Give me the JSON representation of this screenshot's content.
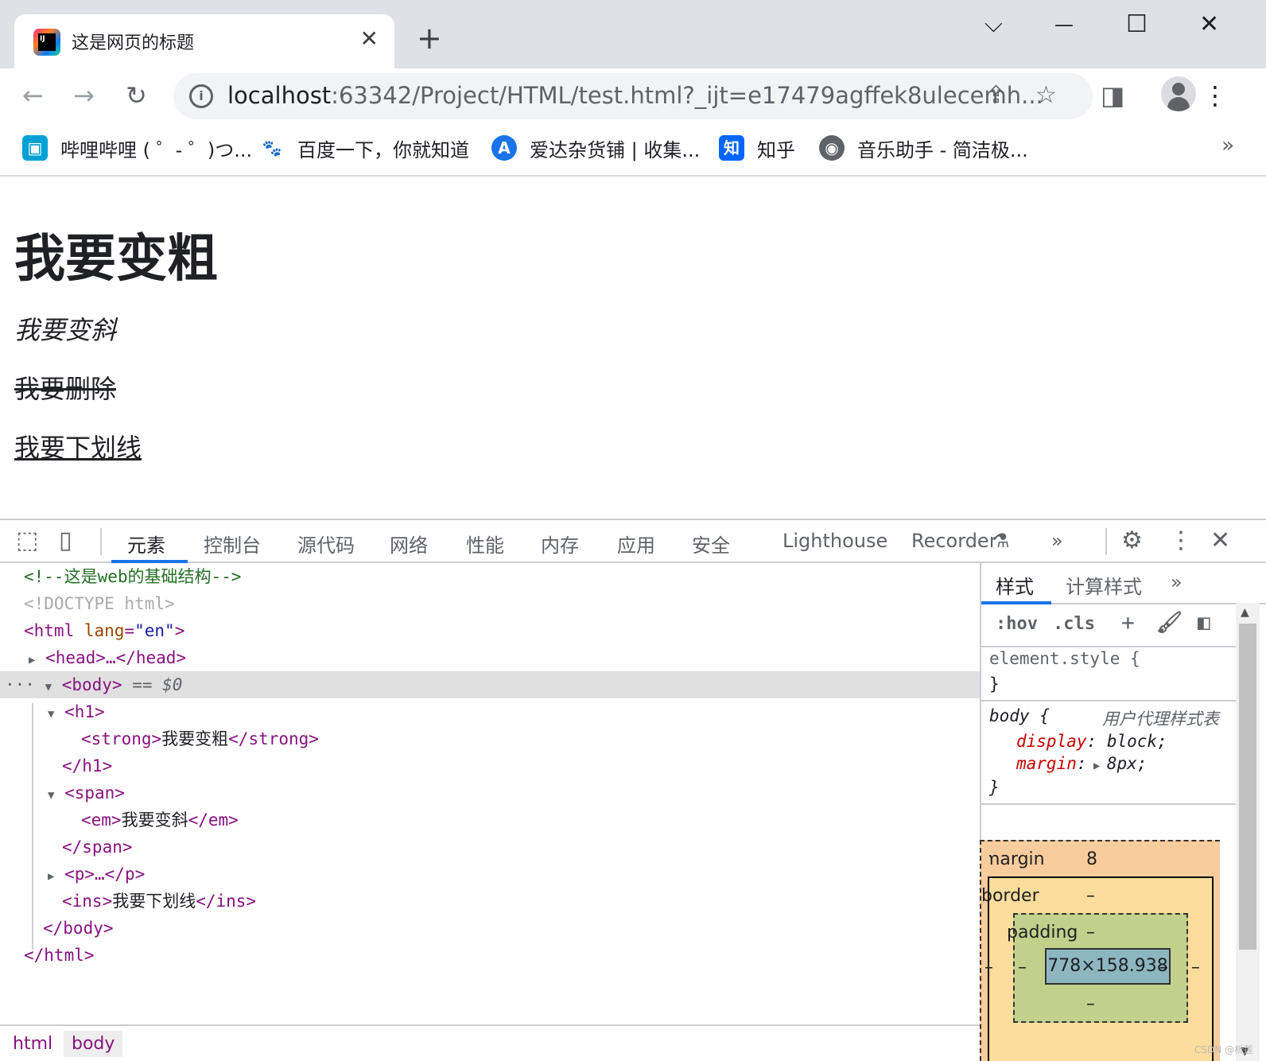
{
  "browser": {
    "tab": {
      "title": "这是网页的标题",
      "close": "✕"
    },
    "new_tab": "+",
    "window_controls": {
      "dropdown": "⌵",
      "minimize": "—",
      "maximize": "☐",
      "close": "✕"
    },
    "url": {
      "host": "localhost",
      "rest": ":63342/Project/HTML/test.html?_ijt=e17479agffek8ulecemh..."
    },
    "bookmarks": [
      {
        "label": "哔哩哔哩 ( ゜- ゜)つ...",
        "icon": "bilibili-icon",
        "color": "#00a1d6"
      },
      {
        "label": "百度一下，你就知道",
        "icon": "baidu-paw-icon",
        "color": "#2932e1"
      },
      {
        "label": "爱达杂货铺 | 收集...",
        "icon": "letter-a-icon",
        "color": "#1a73e8"
      },
      {
        "label": "知乎",
        "icon": "zhihu-icon",
        "color": "#0066ff"
      },
      {
        "label": "音乐助手 - 简洁极...",
        "icon": "globe-icon",
        "color": "#5f6368"
      }
    ],
    "bookmarks_more": "»"
  },
  "page": {
    "h1": "我要变粗",
    "em": "我要变斜",
    "del": "我要删除",
    "ins": "我要下划线"
  },
  "devtools": {
    "tabs": [
      "元素",
      "控制台",
      "源代码",
      "网络",
      "性能",
      "内存",
      "应用",
      "安全",
      "Lighthouse",
      "Recorder"
    ],
    "active_tab": "元素",
    "more": "»",
    "dom": {
      "comment": "<!--这是web的基础结构-->",
      "doctype": "<!DOCTYPE html>",
      "html_open": "<html",
      "lang_attr": "lang",
      "lang_val": "\"en\"",
      "gt": ">",
      "head": "<head>…</head>",
      "body_open": "<body>",
      "body_eq": "== $0",
      "h1_open": "<h1>",
      "strong_open": "<strong>",
      "strong_text": "我要变粗",
      "strong_close": "</strong>",
      "h1_close": "</h1>",
      "span_open": "<span>",
      "em_open": "<em>",
      "em_text": "我要变斜",
      "em_close": "</em>",
      "span_close": "</span>",
      "p": "<p>…</p>",
      "ins_open": "<ins>",
      "ins_text": "我要下划线",
      "ins_close": "</ins>",
      "body_close": "</body>",
      "html_close": "</html>",
      "ellipsis": "···"
    },
    "breadcrumbs": [
      "html",
      "body"
    ],
    "sidebar": {
      "tabs": [
        "样式",
        "计算样式"
      ],
      "more": "»",
      "tools": {
        "hov": ":hov",
        "cls": ".cls",
        "plus": "+"
      },
      "element_style": "element.style {",
      "close_brace": "}",
      "body_rule": "body {",
      "ua_label": "用户代理样式表",
      "display_prop": "display",
      "display_val": "block;",
      "margin_prop": "margin",
      "margin_val": "8px;",
      "colon": ":"
    },
    "box_model": {
      "margin_label": "margin",
      "margin_value": "8",
      "border_label": "border",
      "border_value": "–",
      "padding_label": "padding",
      "padding_value": "–",
      "content": "778×158.938",
      "dash": "–"
    }
  },
  "watermark": "CSDN @析莲"
}
